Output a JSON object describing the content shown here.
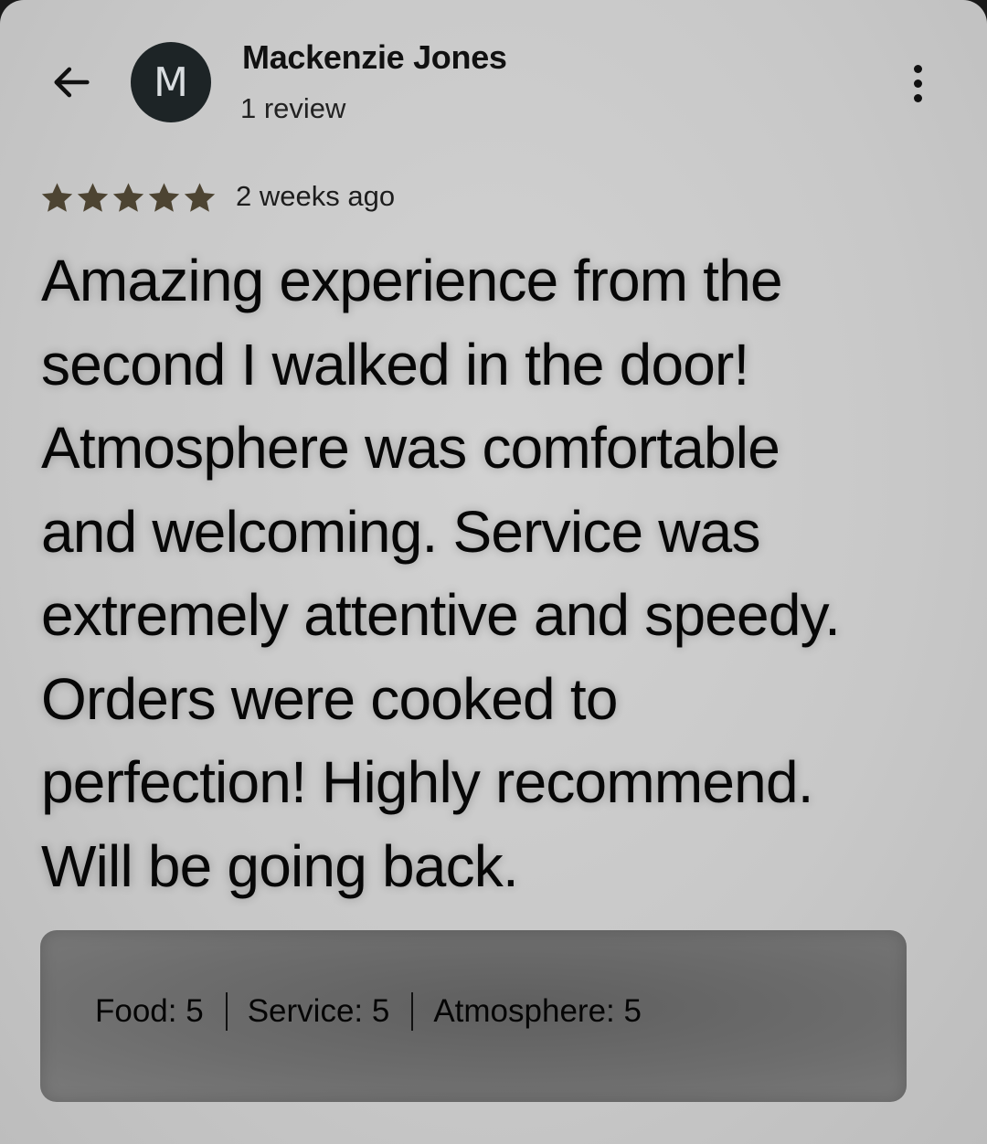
{
  "author": {
    "initial": "M",
    "name": "Mackenzie Jones",
    "review_count": "1 review"
  },
  "review": {
    "rating": 5,
    "rating_max": 5,
    "time_ago": "2 weeks ago",
    "text_lines": [
      "Amazing experience from the",
      "second I walked in the door!",
      "Atmosphere was comfortable",
      "and welcoming. Service was",
      "extremely attentive and speedy.",
      "Orders were cooked to",
      "perfection! Highly recommend.",
      "Will be going back."
    ]
  },
  "ratings": [
    {
      "label": "Food: 5"
    },
    {
      "label": "Service: 5"
    },
    {
      "label": "Atmosphere: 5"
    }
  ],
  "colors": {
    "star": "#4d4432",
    "avatar_bg": "#1d2426"
  },
  "icons": {
    "back": "arrow-back-icon",
    "menu": "more-vertical-icon",
    "star": "star-icon"
  }
}
